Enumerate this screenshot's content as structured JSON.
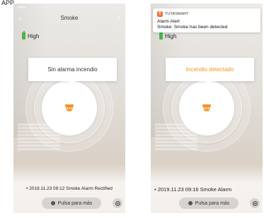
{
  "app_label": "APP",
  "left_phone": {
    "title": "Smoke",
    "battery_label": "High",
    "popup_text": "Sin alarma incendio",
    "log_text": "• 2019.11.23 09:12 Smoke Alarm Rectified",
    "more_button": "Pulsa para más"
  },
  "right_phone": {
    "battery_label": "High",
    "popup_text": "Incendio detectado",
    "log_text": "• 2019.11.23 09:16 Smoke Alarm",
    "more_button": "Pulsa para más",
    "notification": {
      "app_name": "TUYASMART",
      "title": "Alarm Alert",
      "body": "Smoke: Smoke has been detected"
    }
  },
  "colors": {
    "alarm_orange": "#f29325",
    "battery_green": "#4bb34b",
    "notification_icon": "#f4743b"
  },
  "icons": [
    "battery-icon",
    "smoke-detector-icon",
    "gear-icon",
    "tuya-app-icon"
  ]
}
